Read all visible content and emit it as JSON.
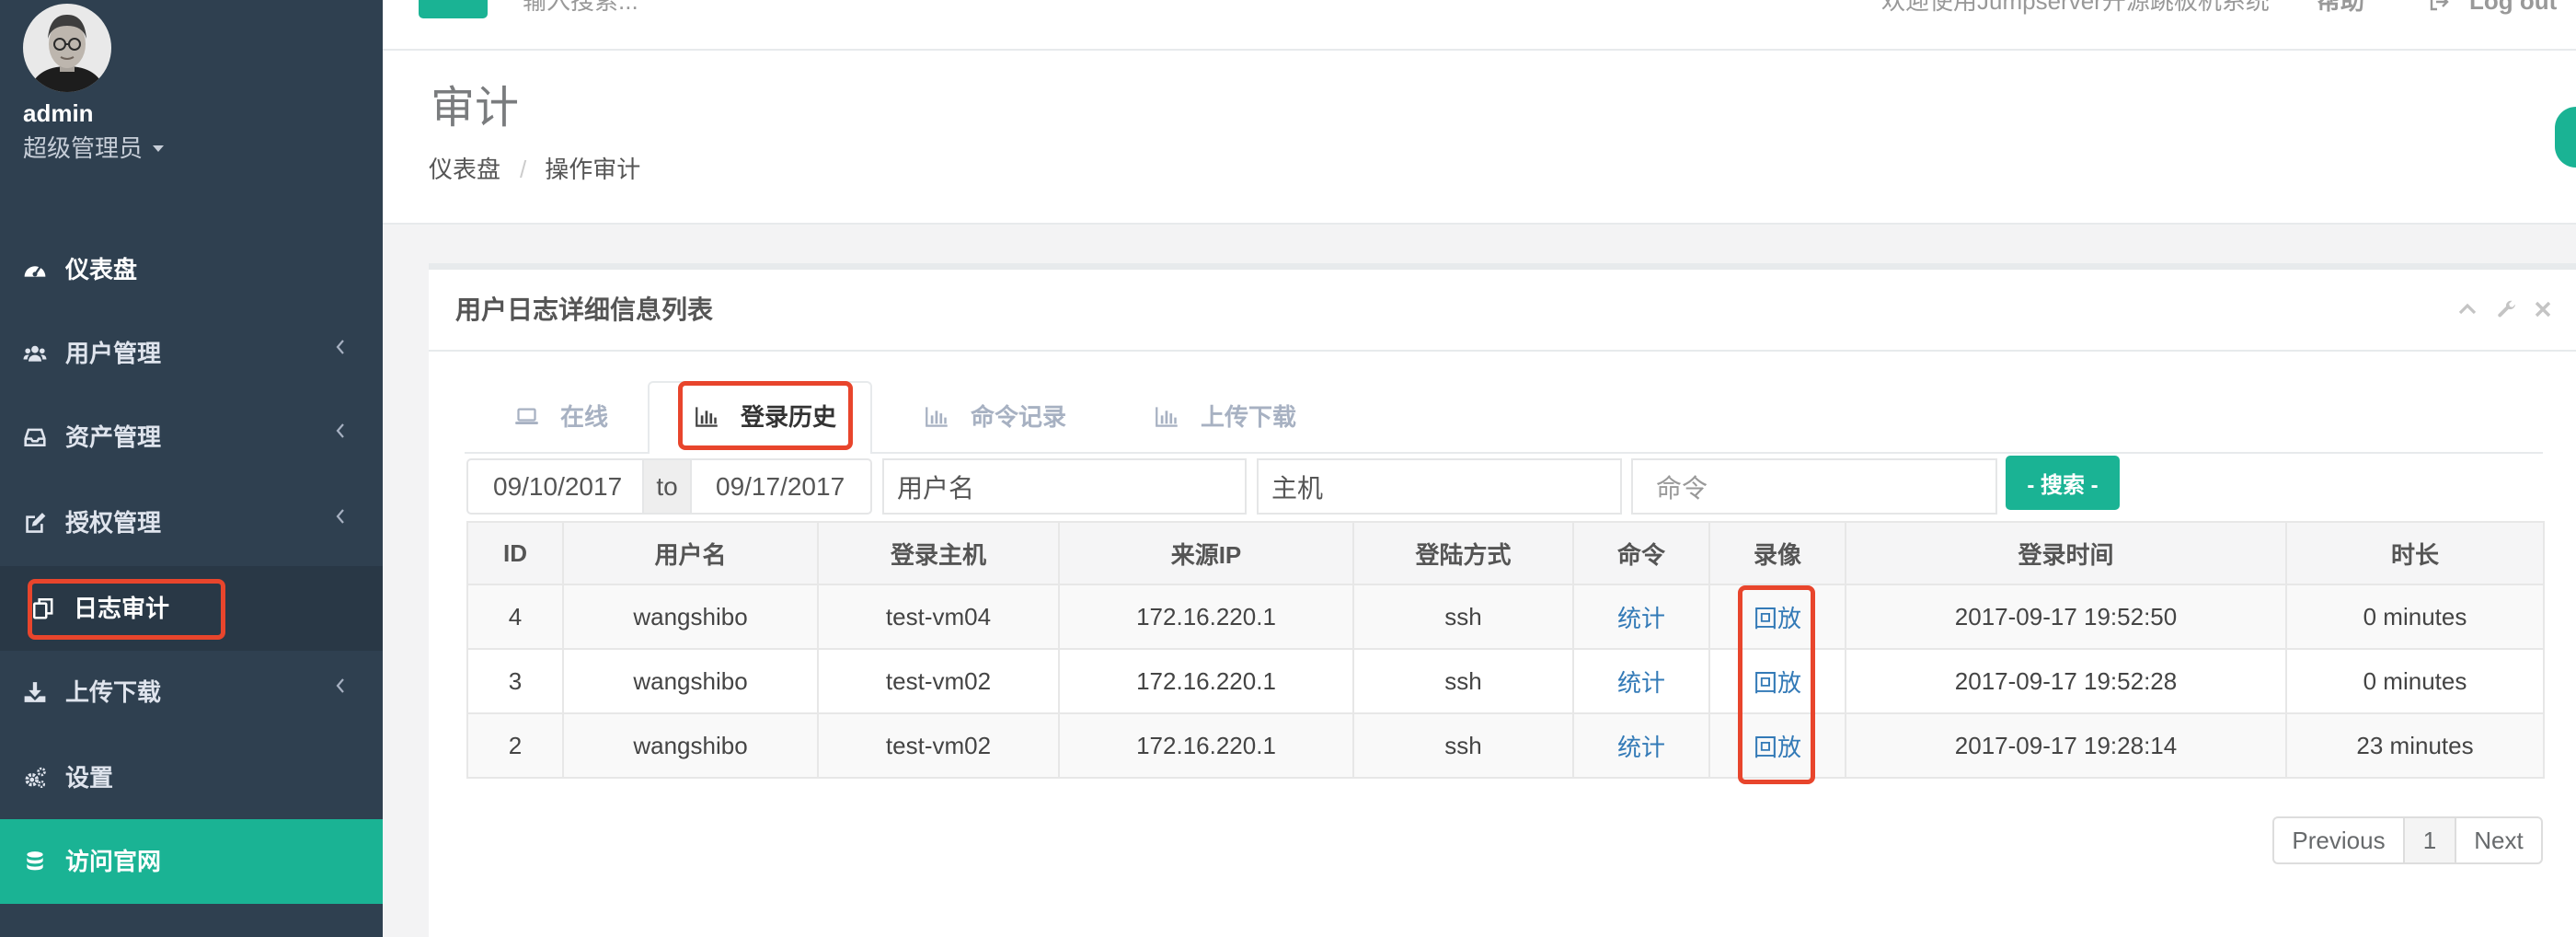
{
  "colors": {
    "sidebar_bg": "#2f4050",
    "sidebar_active_bg": "#293846",
    "accent": "#1ab394",
    "link": "#337ab7",
    "annotation": "#e8452c",
    "page_bg": "#f3f3f4"
  },
  "topbar": {
    "toggle_icon": "bars-icon",
    "search_placeholder": "输入搜索...",
    "welcome": "欢迎使用Jumpserver开源跳板机系统",
    "help": "帮助",
    "logout_icon": "sign-out-icon",
    "logout": "Log out"
  },
  "sidebar": {
    "user_name": "admin",
    "user_role": "超级管理员",
    "items": [
      {
        "label": "仪表盘",
        "icon": "dashboard-icon",
        "submenu": false
      },
      {
        "label": "用户管理",
        "icon": "users-icon",
        "submenu": true
      },
      {
        "label": "资产管理",
        "icon": "inbox-icon",
        "submenu": true
      },
      {
        "label": "授权管理",
        "icon": "edit-icon",
        "submenu": true
      },
      {
        "label": "日志审计",
        "icon": "files-icon",
        "submenu": false,
        "active": true
      },
      {
        "label": "上传下载",
        "icon": "download-icon",
        "submenu": true
      },
      {
        "label": "设置",
        "icon": "cogs-icon",
        "submenu": false
      },
      {
        "label": "访问官网",
        "icon": "database-icon",
        "submenu": false,
        "highlight": true
      }
    ]
  },
  "page": {
    "title": "审计",
    "breadcrumb": {
      "home": "仪表盘",
      "separator": "/",
      "current": "操作审计"
    }
  },
  "panel": {
    "title": "用户日志详细信息列表",
    "tools": [
      "chevron-up-icon",
      "wrench-icon",
      "close-icon"
    ]
  },
  "tabs": [
    {
      "label": "在线",
      "icon": "laptop-icon"
    },
    {
      "label": "登录历史",
      "icon": "bar-chart-icon",
      "active": true
    },
    {
      "label": "命令记录",
      "icon": "bar-chart-icon"
    },
    {
      "label": "上传下载",
      "icon": "bar-chart-icon"
    }
  ],
  "filters": {
    "date_from": "09/10/2017",
    "date_separator": "to",
    "date_to": "09/17/2017",
    "user": "用户名",
    "host": "主机",
    "command_placeholder": "命令",
    "search_button": "- 搜索 -"
  },
  "table": {
    "headers": {
      "id": "ID",
      "user": "用户名",
      "host": "登录主机",
      "ip": "来源IP",
      "method": "登陆方式",
      "command": "命令",
      "replay": "录像",
      "time": "登录时间",
      "duration": "时长"
    },
    "rows": [
      {
        "id": "4",
        "user": "wangshibo",
        "host": "test-vm04",
        "ip": "172.16.220.1",
        "method": "ssh",
        "command": "统计",
        "replay": "回放",
        "time": "2017-09-17 19:52:50",
        "duration": "0 minutes"
      },
      {
        "id": "3",
        "user": "wangshibo",
        "host": "test-vm02",
        "ip": "172.16.220.1",
        "method": "ssh",
        "command": "统计",
        "replay": "回放",
        "time": "2017-09-17 19:52:28",
        "duration": "0 minutes"
      },
      {
        "id": "2",
        "user": "wangshibo",
        "host": "test-vm02",
        "ip": "172.16.220.1",
        "method": "ssh",
        "command": "统计",
        "replay": "回放",
        "time": "2017-09-17 19:28:14",
        "duration": "23 minutes"
      }
    ]
  },
  "pagination": {
    "previous": "Previous",
    "current_page": "1",
    "next": "Next"
  }
}
